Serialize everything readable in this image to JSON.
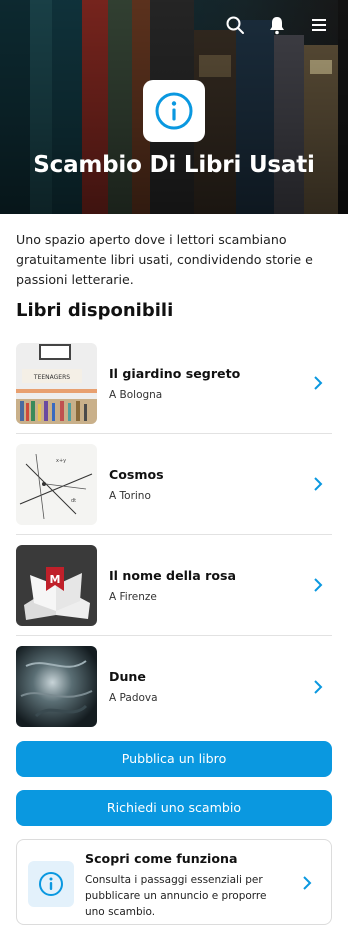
{
  "hero": {
    "title": "Scambio Di Libri Usati",
    "icons": [
      "search-icon",
      "notification-bell-icon",
      "menu-icon"
    ],
    "badge_icon": "info-icon"
  },
  "intro": {
    "text": "Uno spazio aperto dove i lettori scambiano gratuitamente libri usati, condividendo storie e passioni letterarie."
  },
  "books_section": {
    "title": "Libri disponibili",
    "items": [
      {
        "title": "Il giardino segreto",
        "city": "A Bologna",
        "thumb_label": "TEENAGERS"
      },
      {
        "title": "Cosmos",
        "city": "A Torino"
      },
      {
        "title": "Il nome della rosa",
        "city": "A Firenze"
      },
      {
        "title": "Dune",
        "city": "A Padova"
      }
    ]
  },
  "actions": {
    "publish_label": "Pubblica un libro",
    "request_label": "Richiedi uno scambio"
  },
  "info_card": {
    "title": "Scopri come funziona",
    "text": "Consulta i passaggi essenziali per pubblicare un annuncio e proporre uno scambio.",
    "icon": "info-icon"
  },
  "colors": {
    "accent": "#0a98e0",
    "info_bg": "#e3f1fb"
  }
}
